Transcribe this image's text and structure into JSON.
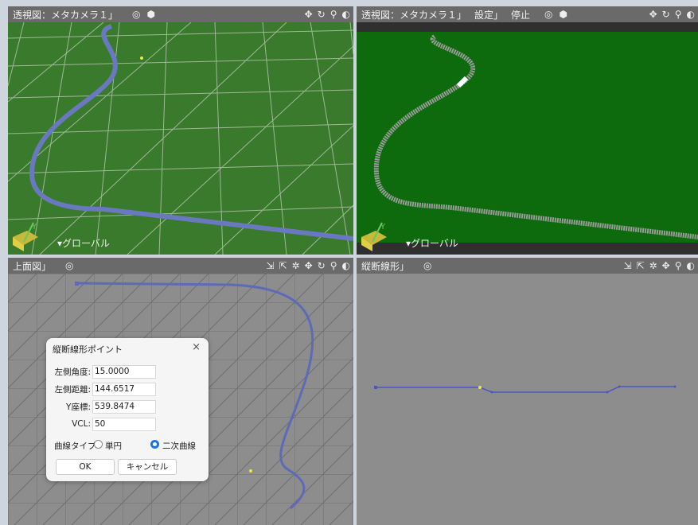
{
  "viewport_tl": {
    "title": "透視図：メタカメラ１」",
    "icons": [
      "target-icon",
      "cube-icon"
    ],
    "nav": [
      "move-icon",
      "rotate-icon",
      "zoom-icon",
      "zoom-fit-icon"
    ],
    "global_label": "▾グローバル"
  },
  "viewport_tr": {
    "title": "透視図：メタカメラ１」",
    "settings": "設定」",
    "stop": "停止",
    "global_label": "▾グローバル"
  },
  "viewport_bl": {
    "title": "上面図」"
  },
  "viewport_br": {
    "title": "縦断線形」"
  },
  "dialog": {
    "title": "縦断線形ポイント",
    "close": "×",
    "fields": [
      {
        "label": "左側角度:",
        "value": "15.0000"
      },
      {
        "label": "左側距離:",
        "value": "144.6517"
      },
      {
        "label": "Y座標:",
        "value": "539.8474"
      },
      {
        "label": "VCL:",
        "value": "50"
      }
    ],
    "curve_type_label": "曲線タイプ",
    "option_single": "単円",
    "option_quadratic": "二次曲線",
    "ok": "OK",
    "cancel": "キャンセル"
  },
  "colors": {
    "toolbar": "#6a6a6a",
    "ground_green": "#3a7a2c",
    "field_green": "#0d6b0d",
    "road_blue": "#6a78c0",
    "grid_gray": "#7a7a7a",
    "radio_blue": "#1a73e8"
  }
}
